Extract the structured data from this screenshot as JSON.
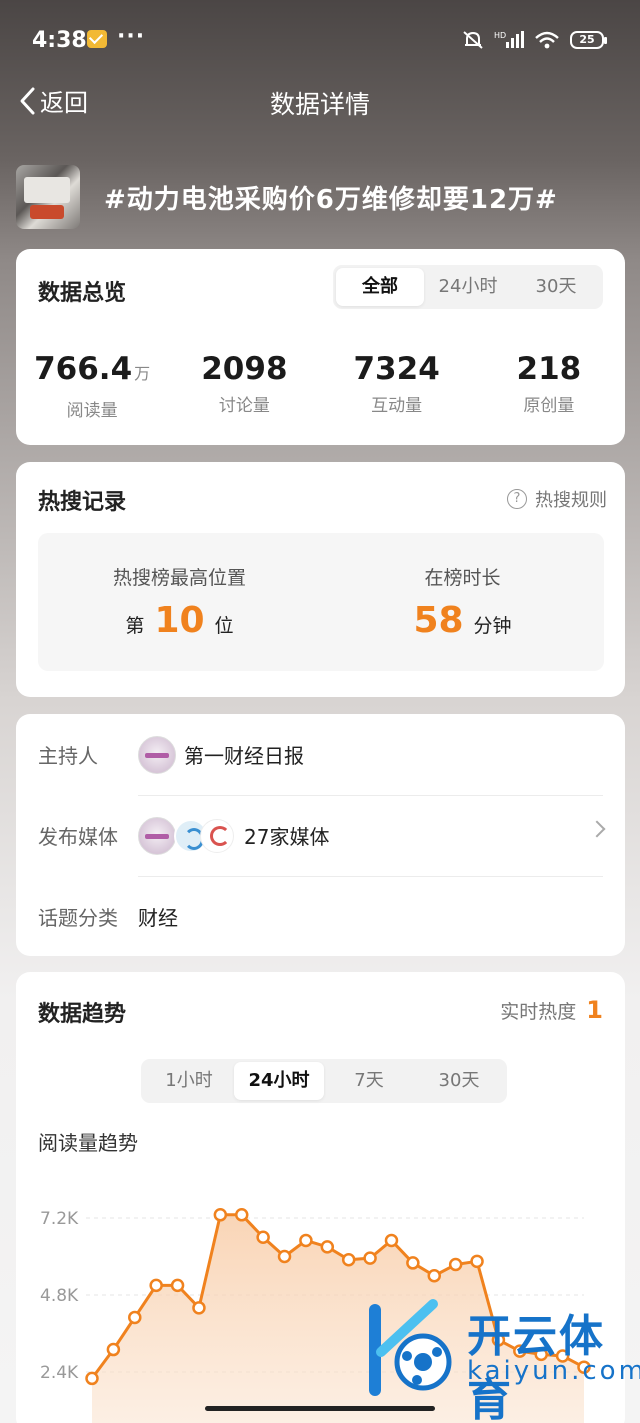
{
  "status_bar": {
    "time": "4:38",
    "more": "···",
    "battery": "25",
    "net": "HD"
  },
  "nav": {
    "back_label": "返回",
    "title": "数据详情"
  },
  "topic": {
    "title": "#动力电池采购价6万维修却要12万#"
  },
  "overview": {
    "title": "数据总览",
    "tabs": [
      "全部",
      "24小时",
      "30天"
    ],
    "active_tab": "全部",
    "stats": [
      {
        "value": "766.4",
        "unit": "万",
        "label": "阅读量"
      },
      {
        "value": "2098",
        "unit": "",
        "label": "讨论量"
      },
      {
        "value": "7324",
        "unit": "",
        "label": "互动量"
      },
      {
        "value": "218",
        "unit": "",
        "label": "原创量"
      }
    ]
  },
  "hot_search": {
    "title": "热搜记录",
    "rule_label": "热搜规则",
    "peak_label": "热搜榜最高位置",
    "peak_prefix": "第",
    "peak_value": "10",
    "peak_suffix": "位",
    "duration_label": "在榜时长",
    "duration_value": "58",
    "duration_unit": "分钟"
  },
  "info": {
    "host_label": "主持人",
    "host_name": "第一财经日报",
    "media_label": "发布媒体",
    "media_count": "27家媒体",
    "category_label": "话题分类",
    "category": "财经"
  },
  "trend": {
    "title": "数据趋势",
    "heat_label": "实时热度",
    "heat_value": "1",
    "tabs": [
      "1小时",
      "24小时",
      "7天",
      "30天"
    ],
    "active_tab": "24小时",
    "chart_title": "阅读量趋势"
  },
  "chart_data": {
    "type": "area",
    "title": "阅读量趋势",
    "y_ticks": [
      "7.2K",
      "4.8K",
      "2.4K"
    ],
    "y_tick_values": [
      7200,
      4800,
      2400
    ],
    "ylim": [
      1600,
      8000
    ],
    "grid": true,
    "series": [
      {
        "values": [
          2200,
          3100,
          4100,
          5100,
          5100,
          4400,
          7300,
          7300,
          6600,
          6000,
          6500,
          6300,
          5900,
          5950,
          6500,
          5800,
          5400,
          5750,
          5850,
          3400,
          3050,
          2950,
          2900,
          2550
        ]
      }
    ],
    "color": "#f0821e"
  },
  "watermark": {
    "brand": "开云体育",
    "domain": "kaiyun.com"
  }
}
